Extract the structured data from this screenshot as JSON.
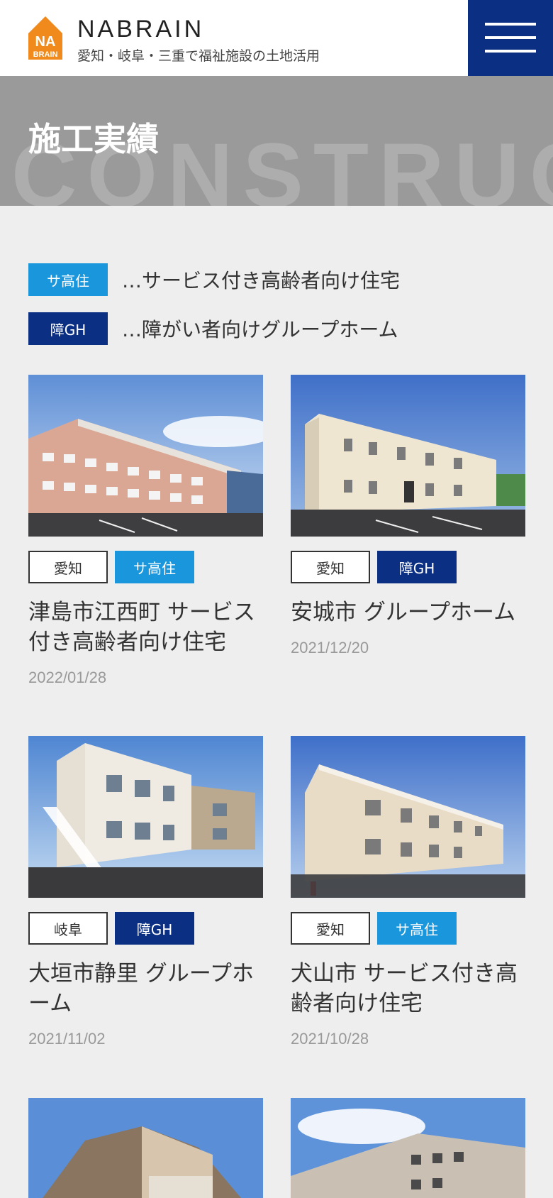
{
  "header": {
    "brand": "NABRAIN",
    "tagline": "愛知・岐阜・三重で福祉施設の土地活用",
    "logo_text_top": "NA",
    "logo_text_bottom": "BRAIN"
  },
  "hero": {
    "title": "施工実績",
    "bg_text": "CONSTRUCTION"
  },
  "legend": [
    {
      "badge": "サ高住",
      "text": "…サービス付き高齢者向け住宅",
      "color": "#1a96dd"
    },
    {
      "badge": "障GH",
      "text": "…障がい者向けグループホーム",
      "color": "#0b2f83"
    }
  ],
  "colors": {
    "sakoju": "#1a96dd",
    "gh": "#0b2f83",
    "menu": "#0b2f83",
    "logo": "#f08a1c"
  },
  "cards": [
    {
      "pref": "愛知",
      "category": "サ高住",
      "title": "津島市江西町 サービス付き高齢者向け住宅",
      "date": "2022/01/28"
    },
    {
      "pref": "愛知",
      "category": "障GH",
      "title": "安城市 グループホーム",
      "date": "2021/12/20"
    },
    {
      "pref": "岐阜",
      "category": "障GH",
      "title": "大垣市静里 グループホーム",
      "date": "2021/11/02"
    },
    {
      "pref": "愛知",
      "category": "サ高住",
      "title": "犬山市 サービス付き高齢者向け住宅",
      "date": "2021/10/28"
    }
  ]
}
